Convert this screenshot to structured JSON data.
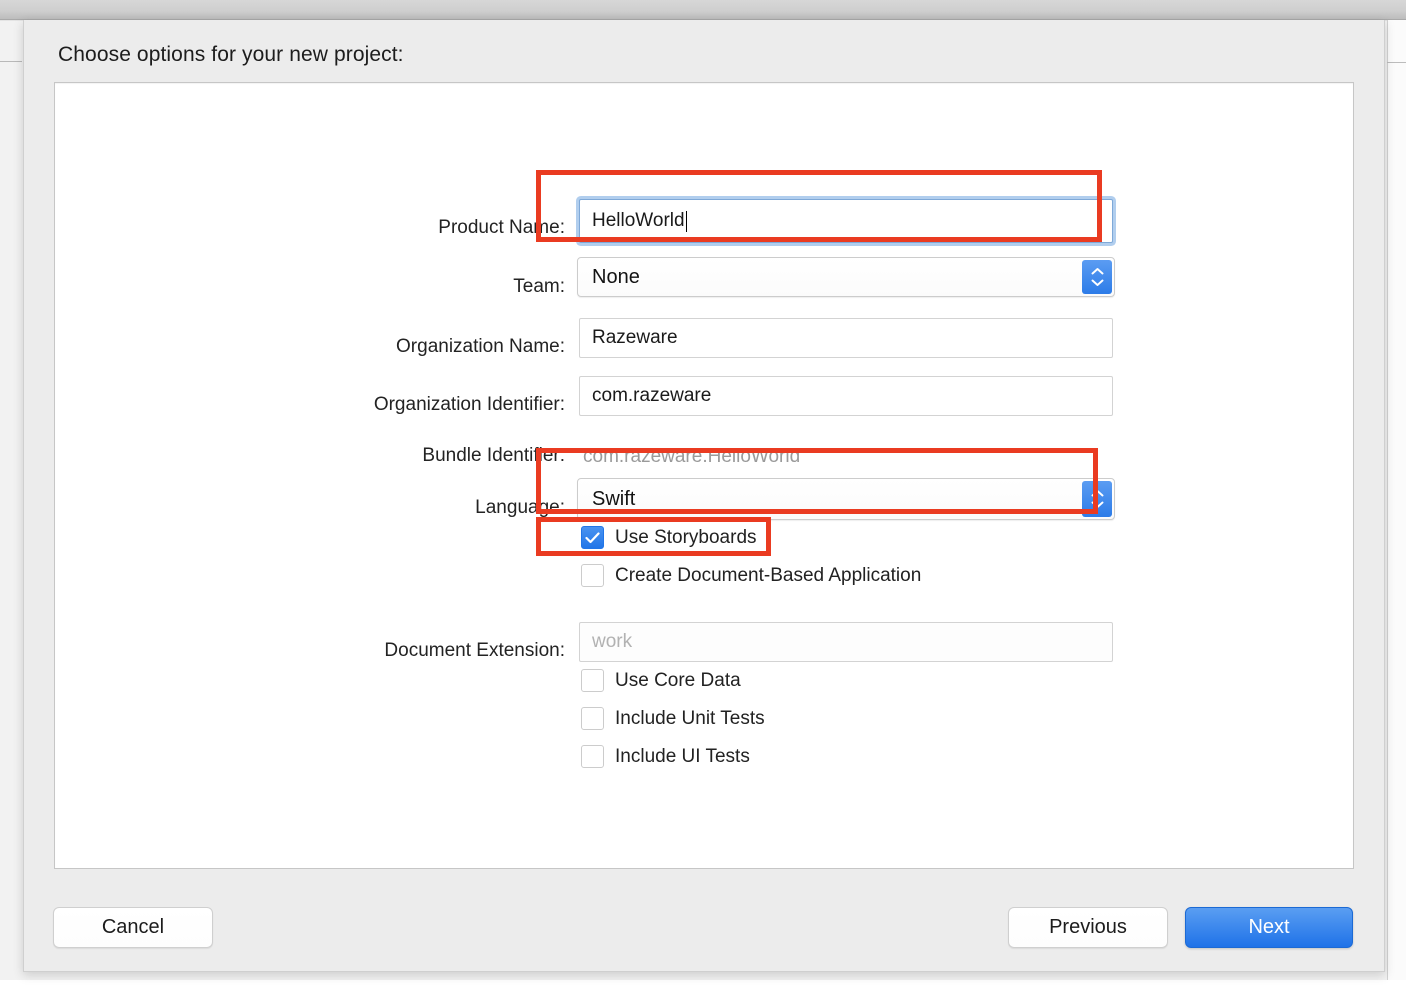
{
  "dialog": {
    "title": "Choose options for your new project:"
  },
  "fields": {
    "product_name": {
      "label": "Product Name:",
      "value": "HelloWorld",
      "placeholder": "",
      "focused": true,
      "highlighted": true
    },
    "team": {
      "label": "Team:",
      "value": "None",
      "type": "popup",
      "highlighted": false
    },
    "organization_name": {
      "label": "Organization Name:",
      "value": "Razeware",
      "placeholder": ""
    },
    "organization_identifier": {
      "label": "Organization Identifier:",
      "value": "com.razeware",
      "placeholder": ""
    },
    "bundle_identifier": {
      "label": "Bundle Identifier:",
      "value": "com.razeware.HelloWorld",
      "readonly": true
    },
    "language": {
      "label": "Language:",
      "value": "Swift",
      "type": "popup",
      "highlighted": true
    },
    "document_extension": {
      "label": "Document Extension:",
      "value": "",
      "placeholder": "work",
      "disabled": true
    }
  },
  "checkboxes": [
    {
      "label": "Use Storyboards",
      "checked": true,
      "highlighted": true
    },
    {
      "label": "Create Document-Based Application",
      "checked": false,
      "highlighted": false
    },
    {
      "label": "Use Core Data",
      "checked": false,
      "highlighted": false
    },
    {
      "label": "Include Unit Tests",
      "checked": false,
      "highlighted": false
    },
    {
      "label": "Include UI Tests",
      "checked": false,
      "highlighted": false
    }
  ],
  "buttons": {
    "cancel": "Cancel",
    "previous": "Previous",
    "next": "Next"
  },
  "colors": {
    "annotation_red": "#ea3b21",
    "accent_blue": "#2176e8",
    "focus_ring": "#7fa9d8",
    "sheet_background": "#ececec",
    "placeholder_gray": "#b2b2b2",
    "readonly_gray": "#9a9a9a"
  },
  "icons": {
    "stepper": "chevron-up-down-icon",
    "checkmark": "checkmark-icon",
    "caret": "text-cursor-icon"
  }
}
